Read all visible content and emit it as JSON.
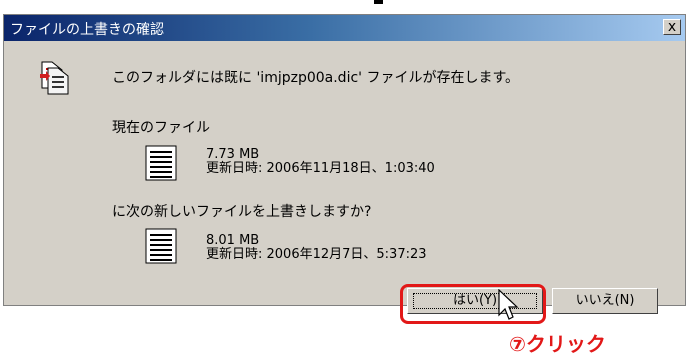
{
  "window": {
    "title": "ファイルの上書きの確認",
    "close_label": "x"
  },
  "dialog": {
    "message": "このフォルダには既に 'imjpzp00a.dic' ファイルが存在します。",
    "current_heading": "現在のファイル",
    "current_file": {
      "size": "7.73 MB",
      "modified": "更新日時: 2006年11月18日、1:03:40"
    },
    "replace_question": "に次の新しいファイルを上書きしますか?",
    "new_file": {
      "size": "8.01 MB",
      "modified": "更新日時: 2006年12月7日、5:37:23"
    }
  },
  "buttons": {
    "yes": "はい(Y)",
    "no": "いいえ(N)"
  },
  "annotation": {
    "callout": "⑦クリック",
    "color": "#e21818"
  }
}
